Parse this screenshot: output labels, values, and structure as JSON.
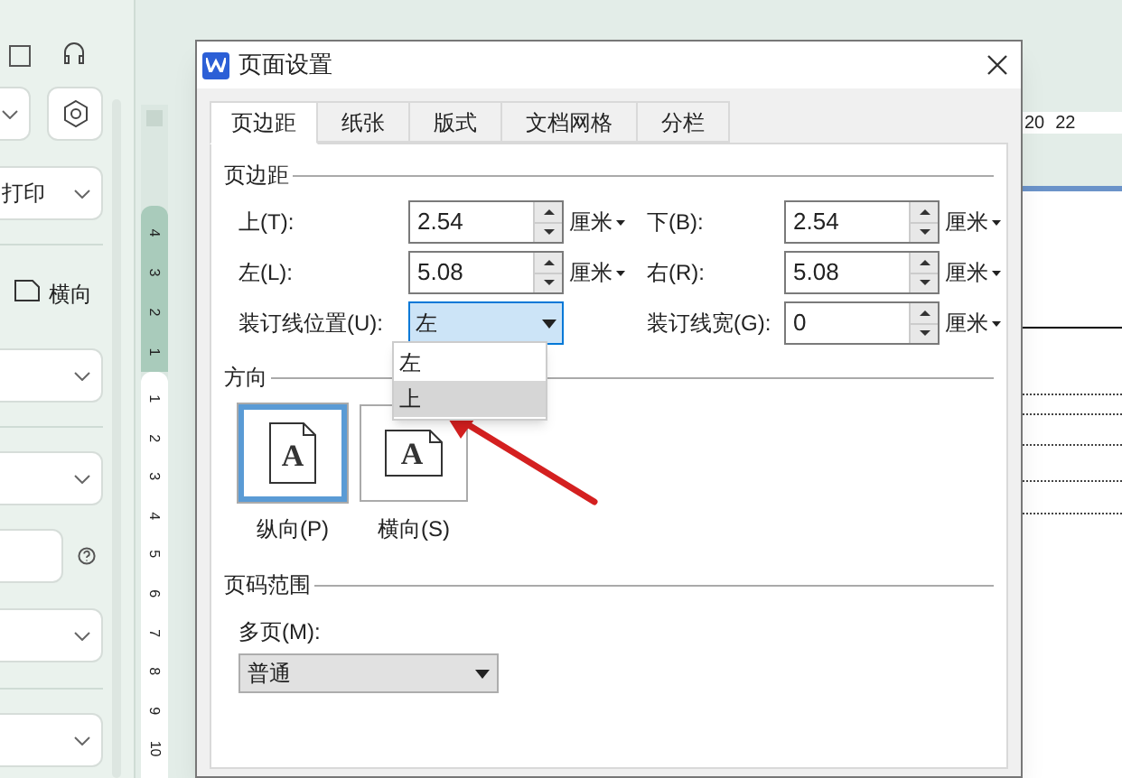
{
  "sidebar": {
    "print_select": {
      "value": "打印"
    },
    "orientation_label": "横向"
  },
  "vertical_ruler": {
    "top_numbers": [
      "4",
      "3",
      "2",
      "1"
    ],
    "numbers": [
      "1",
      "2",
      "3",
      "4",
      "5",
      "6",
      "7",
      "8",
      "9",
      "10"
    ]
  },
  "top_ruler": {
    "numbers": [
      "20",
      "22"
    ]
  },
  "dialog": {
    "title": "页面设置",
    "tabs": [
      {
        "label": "页边距",
        "selected": true
      },
      {
        "label": "纸张",
        "selected": false
      },
      {
        "label": "版式",
        "selected": false
      },
      {
        "label": "文档网格",
        "selected": false
      },
      {
        "label": "分栏",
        "selected": false
      }
    ],
    "margins": {
      "heading": "页边距",
      "fields": [
        {
          "label": "上(T):",
          "value": "2.54",
          "unit": "厘米"
        },
        {
          "label": "下(B):",
          "value": "2.54",
          "unit": "厘米"
        },
        {
          "label": "左(L):",
          "value": "5.08",
          "unit": "厘米"
        },
        {
          "label": "右(R):",
          "value": "5.08",
          "unit": "厘米"
        }
      ],
      "gutter_position": {
        "label": "装订线位置(U):",
        "value": "左",
        "expanded": true,
        "options": [
          {
            "label": "左",
            "highlighted": false
          },
          {
            "label": "上",
            "highlighted": true
          }
        ]
      },
      "gutter_width": {
        "label": "装订线宽(G):",
        "value": "0",
        "unit": "厘米"
      }
    },
    "orientation": {
      "heading": "方向",
      "options": [
        {
          "label": "纵向(P)",
          "kind": "portrait",
          "icon_letter": "A",
          "selected": true
        },
        {
          "label": "横向(S)",
          "kind": "landscape",
          "icon_letter": "A",
          "selected": false
        }
      ]
    },
    "page_range": {
      "heading": "页码范围",
      "label": "多页(M):",
      "value": "普通"
    }
  }
}
